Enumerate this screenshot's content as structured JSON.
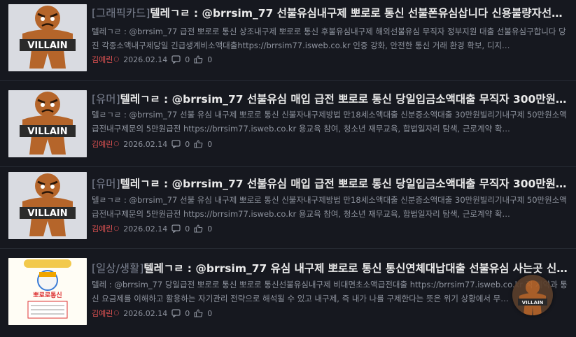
{
  "posts": [
    {
      "category": "[그래픽카드]",
      "title": "텔레ㄱㄹ : @brrsim_77 선불유심내구제 뽀로로 통신 선불폰유심삽니다 신용불량자선…",
      "excerpt": "텔레ㄱㄹ : @brrsim_77 급전 뽀로로 통신 상조내구제 뽀로로 통신 후불유심내구제 해외선불유심 무직자 정부지원 대출 선불유심구합니다 당진 각종소액내구제당일 긴급생계비소액대출https://brrsim77.isweb.co.kr 인증 강화, 안전한 통신 거래 환경 확보, 디지…",
      "author": "김예린",
      "date": "2026.02.14",
      "comments": "0",
      "likes": "0",
      "thumb_text": "VILLAIN"
    },
    {
      "category": "[유머]",
      "title": "텔레ㄱㄹ : @brrsim_77 선불유심 매입 급전 뽀로로 통신 당일입금소액대출 무직자 300만원 …",
      "excerpt": "텔ㄹㄱㄹ : @brrsim_77 선불 유심 내구제 뽀로로 통신 신불자내구제방법 만18세소액대출 신분증소액대출 30만원빌리기내구제 50만원소액급전내구제문의 5만원급전 https://brrsim77.isweb.co.kr 용교육 참여, 청소년 재무교육, 합법일자리 탐색, 근로계약 확…",
      "author": "김예린",
      "date": "2026.02.14",
      "comments": "0",
      "likes": "0",
      "thumb_text": "VILLAIN"
    },
    {
      "category": "[유머]",
      "title": "텔레ㄱㄹ : @brrsim_77 선불유심 매입 급전 뽀로로 통신 당일입금소액대출 무직자 300만원 …",
      "excerpt": "텔ㄹㄱㄹ : @brrsim_77 선불 유심 내구제 뽀로로 통신 신불자내구제방법 만18세소액대출 신분증소액대출 30만원빌리기내구제 50만원소액급전내구제문의 5만원급전 https://brrsim77.isweb.co.kr 용교육 참여, 청소년 재무교육, 합법일자리 탐색, 근로계약 확…",
      "author": "김예린",
      "date": "2026.02.14",
      "comments": "0",
      "likes": "0",
      "thumb_text": "VILLAIN"
    },
    {
      "category": "[일상/생활]",
      "title": "텔레ㄱㄹ : @brrsim_77 유심 내구제 뽀로로 통신 통신연체대납대출 선불유심 사는곳 신…",
      "excerpt": "텔레 : @brrsim_77 당일급전 뽀로로 통신 뽀로로 통신선불유심내구제 비대면초소액급전대출 https://brrsim77.isweb.co.kr 적 계약과 통신 요금제를 이해하고 활용하는 자기관리 전략으로 해석될 수 있고 내구제, 즉 내가 나를 구제한다는 뜻은 위기 상황에서 무…",
      "author": "김예린",
      "date": "2026.02.14",
      "comments": "0",
      "likes": "0",
      "thumb_text": "뽀로로통신"
    }
  ],
  "floating_badge_text": "VILLAIN",
  "colors": {
    "background": "#16181f",
    "author": "#e05252",
    "muted": "#8e939e"
  }
}
